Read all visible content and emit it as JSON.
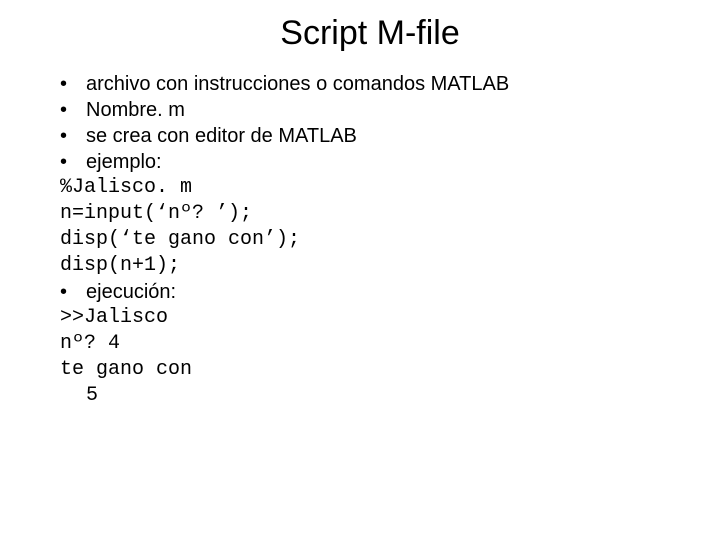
{
  "title": "Script M-file",
  "bullets": {
    "b1": "archivo con instrucciones o comandos MATLAB",
    "b2": "Nombre. m",
    "b3": "se crea con editor de MATLAB",
    "b4": "ejemplo:",
    "b5": "ejecución:"
  },
  "code": {
    "c1": "%Jalisco. m",
    "c2": "n=input(‘nº? ’);",
    "c3": "disp(‘te gano con’);",
    "c4": "disp(n+1);",
    "c5": ">>Jalisco",
    "c6": "nº? 4",
    "c7": "te gano con",
    "c8": " 5"
  },
  "bullet_glyph": "•"
}
